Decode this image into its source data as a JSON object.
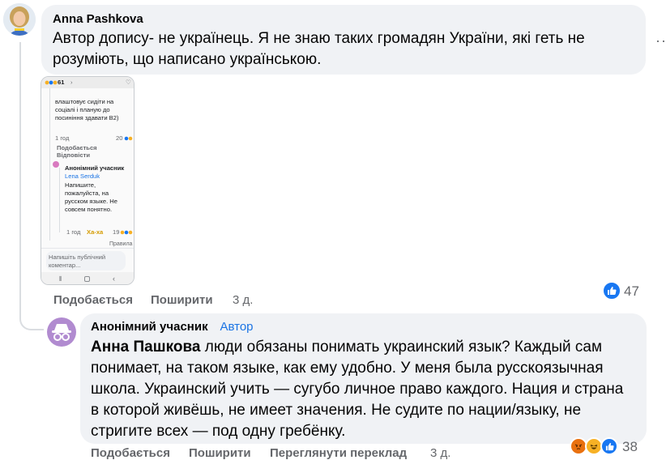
{
  "comment1": {
    "author": "Anna Pashkova",
    "text": "Автор допису- не українець. Я не знаю таких громадян України, які геть не розуміють, що написано українською.",
    "actions": {
      "like": "Подобається",
      "share": "Поширити",
      "time": "3 д."
    },
    "reaction_count": "47"
  },
  "phone": {
    "status_count": "61",
    "reply1_text": "влаштовує сидіти на соціалі і планую до посиніння здавати В2)",
    "reply1_time": "1 год",
    "reply1_count": "20",
    "reply1_like": "Подобається",
    "reply1_reply": "Відповісти",
    "reply2_author": "Анонімний учасник",
    "reply2_mention": "Lena Serduk",
    "reply2_text": "Напишите, пожалуйста, на русском языке. Не совсем понятно.",
    "reply2_time": "1 год",
    "reply2_reaction": "Ха-ха",
    "reply2_count": "19",
    "rules": "Правила",
    "input_placeholder": "Напишіть публічний коментар..."
  },
  "comment2": {
    "author": "Анонімний учасник",
    "author_tag": "Автор",
    "mention": "Анна Пашкова",
    "text": " люди обязаны понимать украинский язык? Каждый сам понимает, на таком языке, как ему удобно. У меня была русскоязычная школа. Украинский учить — сугубо личное право каждого. Нация и страна в которой живёшь, не имеет значения. Не судите по нации/языку, не стригите всех — под одну гребёнку.",
    "actions": {
      "like": "Подобається",
      "share": "Поширити",
      "translate": "Переглянути переклад",
      "time": "3 д."
    },
    "reaction_count": "38"
  },
  "colors": {
    "bubble": "#f0f2f5",
    "muted": "#65676b",
    "link": "#1b74e4",
    "like": "#1877f2",
    "angry": "#e9710f",
    "haha": "#f7b125"
  }
}
